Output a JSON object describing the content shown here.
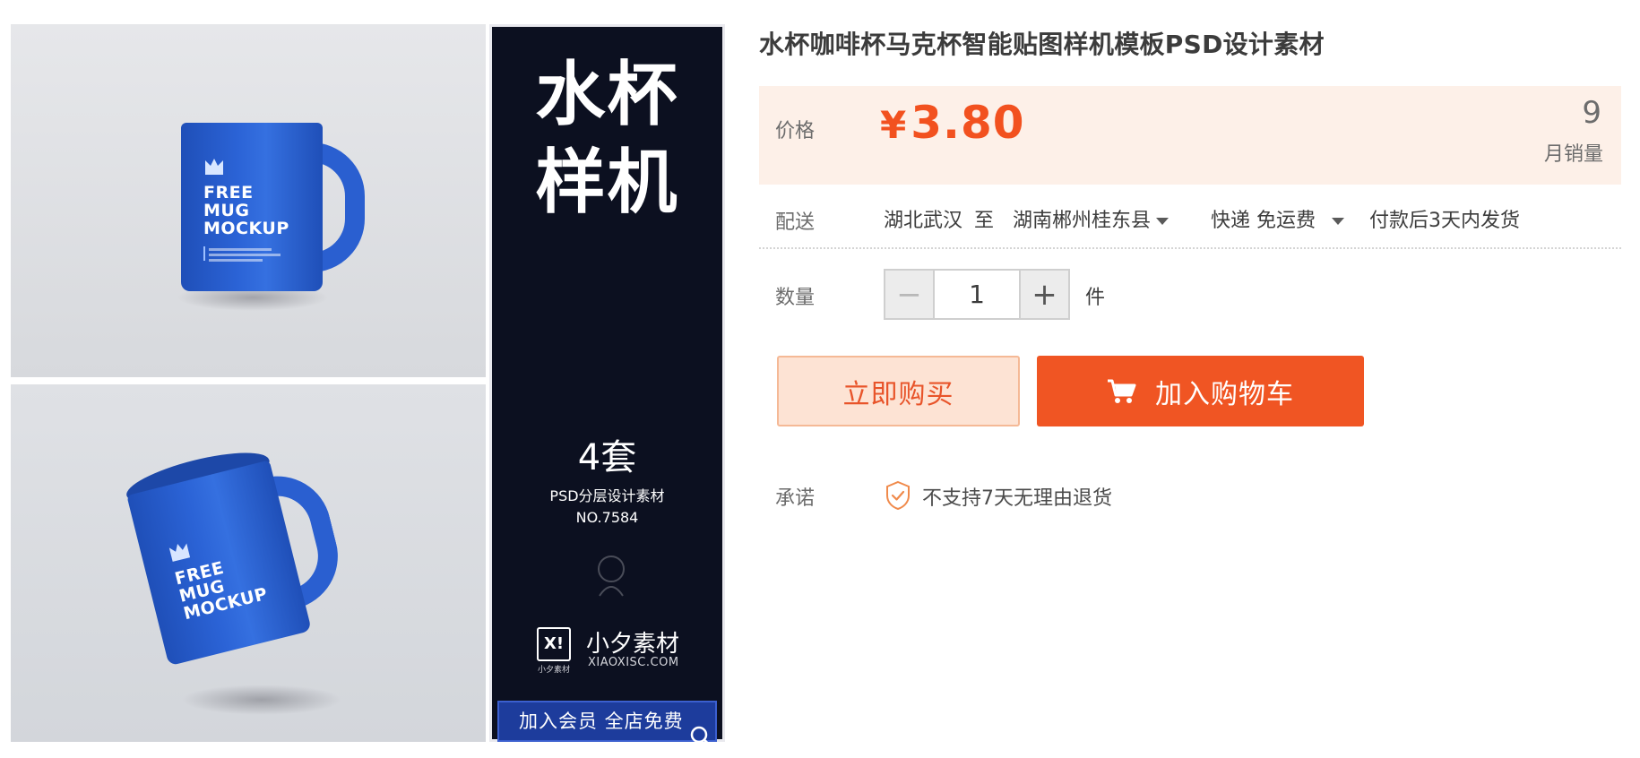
{
  "gallery": {
    "mug_print": [
      "FREE",
      "MUG",
      "MOCKUP"
    ],
    "promo": {
      "headline_line1": "水杯",
      "headline_line2": "样机",
      "count": "4套",
      "subtitle": "PSD分层设计素材",
      "number": "NO.7584",
      "brand_logo": "X!",
      "brand_logo_caption": "小夕素材",
      "brand_name": "小夕素材",
      "brand_url": "XIAOXISC.COM",
      "banner": "加入会员 全店免费"
    },
    "icons": {
      "zoom": "magnifier-icon"
    }
  },
  "product": {
    "title": "水杯咖啡杯马克杯智能贴图样机模板PSD设计素材"
  },
  "price_box": {
    "label": "价格",
    "currency": "¥",
    "price": "3.80",
    "monthly_sales": "9",
    "monthly_sales_label": "月销量"
  },
  "delivery": {
    "label": "配送",
    "from": "湖北武汉",
    "to_word": "至",
    "to": "湖南郴州桂东县",
    "method": "快递",
    "fee": "免运费",
    "ship_time": "付款后3天内发货"
  },
  "quantity": {
    "label": "数量",
    "value": "1",
    "minus": "−",
    "plus": "+",
    "unit": "件"
  },
  "actions": {
    "buy_now": "立即购买",
    "add_to_cart": "加入购物车"
  },
  "promise": {
    "label": "承诺",
    "text": "不支持7天无理由退货",
    "icon": "shield-check-icon"
  },
  "colors": {
    "accent": "#f05523",
    "price": "#f2511f",
    "price_bg": "#fdf0e8",
    "mug_blue": "#2a5fd0",
    "promo_bg": "#0c1020"
  }
}
